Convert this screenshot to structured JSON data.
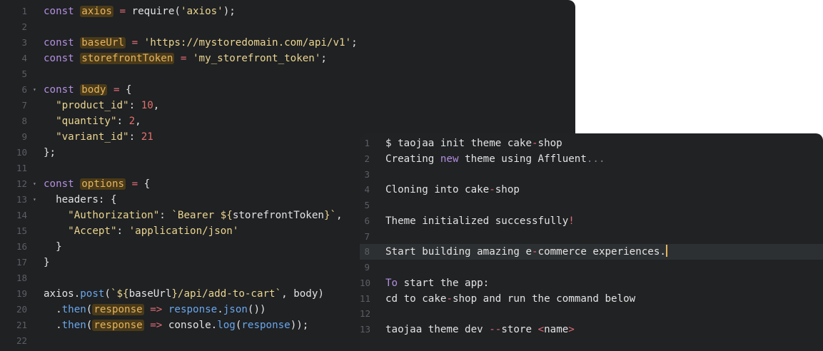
{
  "code_editor": {
    "lines": [
      {
        "num": "1",
        "fold": "",
        "tokens": [
          [
            "kw",
            "const "
          ],
          [
            "var",
            "axios"
          ],
          [
            "op",
            " = "
          ],
          [
            "plain",
            "require("
          ],
          [
            "str",
            "'axios'"
          ],
          [
            "plain",
            ");"
          ]
        ]
      },
      {
        "num": "2",
        "fold": "",
        "tokens": []
      },
      {
        "num": "3",
        "fold": "",
        "tokens": [
          [
            "kw",
            "const "
          ],
          [
            "var",
            "baseUrl"
          ],
          [
            "op",
            " = "
          ],
          [
            "str",
            "'https://mystoredomain.com/api/v1'"
          ],
          [
            "plain",
            ";"
          ]
        ]
      },
      {
        "num": "4",
        "fold": "",
        "tokens": [
          [
            "kw",
            "const "
          ],
          [
            "var",
            "storefrontToken"
          ],
          [
            "op",
            " = "
          ],
          [
            "str",
            "'my_storefront_token'"
          ],
          [
            "plain",
            ";"
          ]
        ]
      },
      {
        "num": "5",
        "fold": "",
        "tokens": []
      },
      {
        "num": "6",
        "fold": "▾",
        "tokens": [
          [
            "kw",
            "const "
          ],
          [
            "var",
            "body"
          ],
          [
            "op",
            " = "
          ],
          [
            "plain",
            "{"
          ]
        ]
      },
      {
        "num": "7",
        "fold": "",
        "tokens": [
          [
            "plain",
            "  "
          ],
          [
            "str",
            "\"product_id\""
          ],
          [
            "plain",
            ": "
          ],
          [
            "num",
            "10"
          ],
          [
            "plain",
            ","
          ]
        ]
      },
      {
        "num": "8",
        "fold": "",
        "tokens": [
          [
            "plain",
            "  "
          ],
          [
            "str",
            "\"quantity\""
          ],
          [
            "plain",
            ": "
          ],
          [
            "num",
            "2"
          ],
          [
            "plain",
            ","
          ]
        ]
      },
      {
        "num": "9",
        "fold": "",
        "tokens": [
          [
            "plain",
            "  "
          ],
          [
            "str",
            "\"variant_id\""
          ],
          [
            "plain",
            ": "
          ],
          [
            "num",
            "21"
          ]
        ]
      },
      {
        "num": "10",
        "fold": "",
        "tokens": [
          [
            "plain",
            "};"
          ]
        ]
      },
      {
        "num": "11",
        "fold": "",
        "tokens": []
      },
      {
        "num": "12",
        "fold": "▾",
        "tokens": [
          [
            "kw",
            "const "
          ],
          [
            "var",
            "options"
          ],
          [
            "op",
            " = "
          ],
          [
            "plain",
            "{"
          ]
        ]
      },
      {
        "num": "13",
        "fold": "▾",
        "tokens": [
          [
            "plain",
            "  headers: {"
          ]
        ]
      },
      {
        "num": "14",
        "fold": "",
        "tokens": [
          [
            "plain",
            "    "
          ],
          [
            "str",
            "\"Authorization\""
          ],
          [
            "plain",
            ": "
          ],
          [
            "str",
            "`Bearer ${"
          ],
          [
            "plain",
            "storefrontToken"
          ],
          [
            "str",
            "}`"
          ],
          [
            "plain",
            ","
          ]
        ]
      },
      {
        "num": "15",
        "fold": "",
        "tokens": [
          [
            "plain",
            "    "
          ],
          [
            "str",
            "\"Accept\""
          ],
          [
            "plain",
            ": "
          ],
          [
            "str",
            "'application/json'"
          ]
        ]
      },
      {
        "num": "16",
        "fold": "",
        "tokens": [
          [
            "plain",
            "  }"
          ]
        ]
      },
      {
        "num": "17",
        "fold": "",
        "tokens": [
          [
            "plain",
            "}"
          ]
        ]
      },
      {
        "num": "18",
        "fold": "",
        "tokens": []
      },
      {
        "num": "19",
        "fold": "",
        "tokens": [
          [
            "plain",
            "axios."
          ],
          [
            "fn",
            "post"
          ],
          [
            "plain",
            "("
          ],
          [
            "str",
            "`${"
          ],
          [
            "plain",
            "baseUrl"
          ],
          [
            "str",
            "}/api/add-to-cart`"
          ],
          [
            "plain",
            ", body)"
          ]
        ]
      },
      {
        "num": "20",
        "fold": "",
        "tokens": [
          [
            "plain",
            "  ."
          ],
          [
            "fn",
            "then"
          ],
          [
            "plain",
            "("
          ],
          [
            "var",
            "response"
          ],
          [
            "op",
            " => "
          ],
          [
            "fn",
            "response"
          ],
          [
            "plain",
            "."
          ],
          [
            "fn",
            "json"
          ],
          [
            "plain",
            "())"
          ]
        ]
      },
      {
        "num": "21",
        "fold": "",
        "tokens": [
          [
            "plain",
            "  ."
          ],
          [
            "fn",
            "then"
          ],
          [
            "plain",
            "("
          ],
          [
            "var",
            "response"
          ],
          [
            "op",
            " => "
          ],
          [
            "plain",
            "console."
          ],
          [
            "fn",
            "log"
          ],
          [
            "plain",
            "("
          ],
          [
            "fn",
            "response"
          ],
          [
            "plain",
            "));"
          ]
        ]
      },
      {
        "num": "22",
        "fold": "",
        "tokens": []
      }
    ]
  },
  "terminal": {
    "lines": [
      {
        "num": "1",
        "tokens": [
          [
            "plain",
            "$ taojaa init theme cake"
          ],
          [
            "op",
            "-"
          ],
          [
            "plain",
            "shop"
          ]
        ]
      },
      {
        "num": "2",
        "tokens": [
          [
            "plain",
            "Creating "
          ],
          [
            "kw",
            "new"
          ],
          [
            "plain",
            " theme using Affluent"
          ],
          [
            "cmt",
            "..."
          ]
        ]
      },
      {
        "num": "3",
        "tokens": []
      },
      {
        "num": "4",
        "tokens": [
          [
            "plain",
            "Cloning into cake"
          ],
          [
            "op",
            "-"
          ],
          [
            "plain",
            "shop"
          ]
        ]
      },
      {
        "num": "5",
        "tokens": []
      },
      {
        "num": "6",
        "tokens": [
          [
            "plain",
            "Theme initialized successfully"
          ],
          [
            "op",
            "!"
          ]
        ]
      },
      {
        "num": "7",
        "tokens": []
      },
      {
        "num": "8",
        "tokens": [
          [
            "plain",
            "Start building amazing e"
          ],
          [
            "op",
            "-"
          ],
          [
            "plain",
            "commerce experiences."
          ]
        ],
        "current": true
      },
      {
        "num": "9",
        "tokens": []
      },
      {
        "num": "10",
        "tokens": [
          [
            "kw",
            "To"
          ],
          [
            "plain",
            " start the app:"
          ]
        ]
      },
      {
        "num": "11",
        "tokens": [
          [
            "plain",
            "cd to cake"
          ],
          [
            "op",
            "-"
          ],
          [
            "plain",
            "shop and run the command below"
          ]
        ]
      },
      {
        "num": "12",
        "tokens": []
      },
      {
        "num": "13",
        "tokens": [
          [
            "plain",
            "taojaa theme dev "
          ],
          [
            "op",
            "--"
          ],
          [
            "plain",
            "store "
          ],
          [
            "op",
            "<"
          ],
          [
            "plain",
            "name"
          ],
          [
            "op",
            ">"
          ]
        ]
      }
    ]
  },
  "colors": {
    "editor_bg": "#1f2123",
    "keyword": "#b48ee0",
    "variable": "#e6b45c",
    "operator": "#e06c75",
    "string": "#ecd58f",
    "number": "#e2706a",
    "function": "#6aa7ec",
    "cursor": "#e6b45c"
  }
}
